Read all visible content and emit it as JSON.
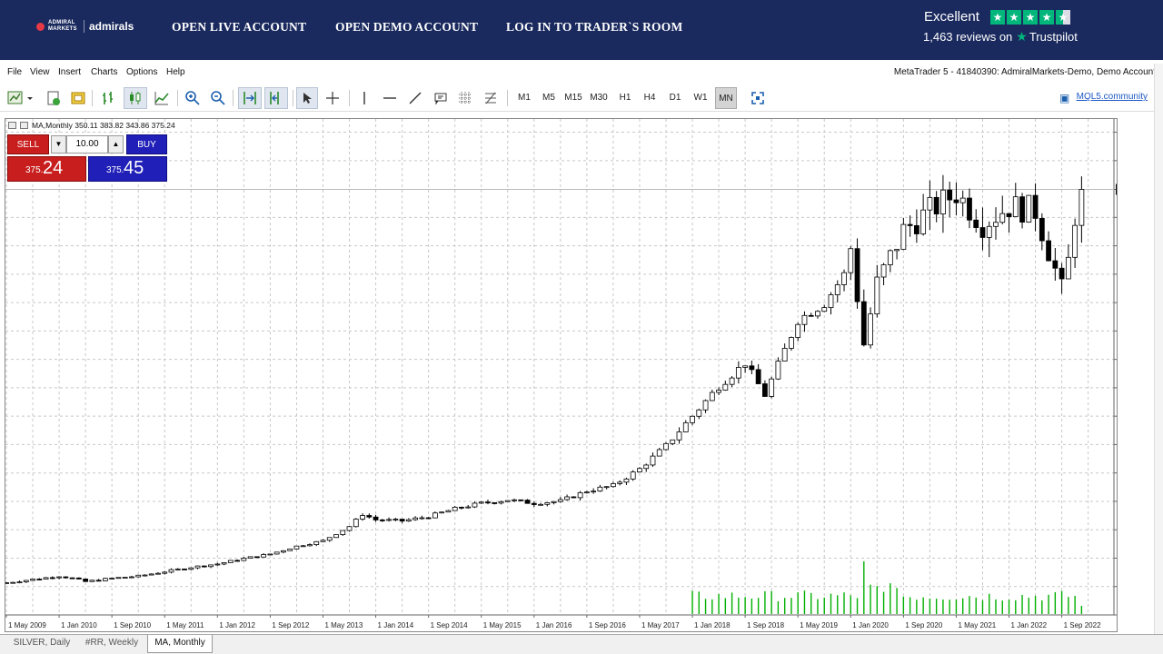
{
  "header": {
    "logo_small": "ADMIRAL MARKETS",
    "logo_big": "admirals",
    "nav": [
      "OPEN LIVE ACCOUNT",
      "OPEN DEMO ACCOUNT",
      "LOG IN TO TRADER`S ROOM"
    ],
    "trustpilot": {
      "rating": "Excellent",
      "reviews": "1,463 reviews on",
      "name": "Trustpilot",
      "stars": 4.5
    }
  },
  "menu": {
    "items": [
      "File",
      "View",
      "Insert",
      "Charts",
      "Options",
      "Help"
    ],
    "account": "MetaTrader 5 - 41840390: AdmiralMarkets-Demo, Demo Account"
  },
  "toolbar": {
    "timeframes": [
      "M1",
      "M5",
      "M15",
      "M30",
      "H1",
      "H4",
      "D1",
      "W1",
      "MN"
    ],
    "active_timeframe": "MN",
    "mql5_label": "MQL5.community"
  },
  "chart": {
    "info": "MA,Monthly  350.11 383.82 343.86 375.24",
    "trade": {
      "sell_label": "SELL",
      "buy_label": "BUY",
      "volume": "10.00",
      "sell_price_prefix": "375.",
      "sell_price_big": "24",
      "buy_price_prefix": "375.",
      "buy_price_big": "45"
    }
  },
  "chart_data": {
    "type": "candlestick",
    "symbol": "MA",
    "timeframe": "Monthly",
    "current_price": 375.24,
    "ylim": [
      -10.17,
      439.0
    ],
    "y_ticks": [
      427.03,
      401.31,
      375.24,
      349.88,
      324.16,
      298.44,
      272.72,
      247.01,
      221.29,
      195.57,
      169.85,
      144.14,
      118.42,
      92.7,
      66.98,
      41.27,
      15.55,
      -10.17
    ],
    "x_ticks": [
      "1 May 2009",
      "1 Jan 2010",
      "1 Sep 2010",
      "1 May 2011",
      "1 Jan 2012",
      "1 Sep 2012",
      "1 May 2013",
      "1 Jan 2014",
      "1 Sep 2014",
      "1 May 2015",
      "1 Jan 2016",
      "1 Sep 2016",
      "1 May 2017",
      "1 Jan 2018",
      "1 Sep 2018",
      "1 May 2019",
      "1 Jan 2020",
      "1 Sep 2020",
      "1 May 2021",
      "1 Jan 2022",
      "1 Sep 2022"
    ],
    "grid": true,
    "close_path": [
      [
        "2009-05",
        19
      ],
      [
        "2009-09",
        22
      ],
      [
        "2010-01",
        25
      ],
      [
        "2010-03",
        23
      ],
      [
        "2010-05",
        20
      ],
      [
        "2010-09",
        23
      ],
      [
        "2011-01",
        25
      ],
      [
        "2011-05",
        29
      ],
      [
        "2011-09",
        33
      ],
      [
        "2012-01",
        36
      ],
      [
        "2012-05",
        41
      ],
      [
        "2012-09",
        45
      ],
      [
        "2013-01",
        52
      ],
      [
        "2013-05",
        57
      ],
      [
        "2013-09",
        70
      ],
      [
        "2013-11",
        81
      ],
      [
        "2014-01",
        76
      ],
      [
        "2014-05",
        75
      ],
      [
        "2014-09",
        79
      ],
      [
        "2015-01",
        86
      ],
      [
        "2015-05",
        91
      ],
      [
        "2015-09",
        94
      ],
      [
        "2016-01",
        91
      ],
      [
        "2016-05",
        93
      ],
      [
        "2016-09",
        102
      ],
      [
        "2017-01",
        107
      ],
      [
        "2017-05",
        122
      ],
      [
        "2017-09",
        143
      ],
      [
        "2018-01",
        170
      ],
      [
        "2018-05",
        197
      ],
      [
        "2018-09",
        218
      ],
      [
        "2018-12",
        189
      ],
      [
        "2019-05",
        257
      ],
      [
        "2019-09",
        272
      ],
      [
        "2019-12",
        298
      ],
      [
        "2020-01",
        322
      ],
      [
        "2020-03",
        235
      ],
      [
        "2020-05",
        290
      ],
      [
        "2020-09",
        338
      ],
      [
        "2021-01",
        356
      ],
      [
        "2021-05",
        372
      ],
      [
        "2021-09",
        344
      ],
      [
        "2022-01",
        360
      ],
      [
        "2022-05",
        356
      ],
      [
        "2022-07",
        320
      ],
      [
        "2022-09",
        285
      ],
      [
        "2022-10",
        310
      ],
      [
        "2022-11",
        352
      ],
      [
        "2022-12",
        375.24
      ]
    ],
    "volume_note": "volume histogram from 2018 onward"
  },
  "tabs": {
    "items": [
      "SILVER, Daily",
      "#RR, Weekly",
      "MA, Monthly"
    ],
    "active": 2
  }
}
